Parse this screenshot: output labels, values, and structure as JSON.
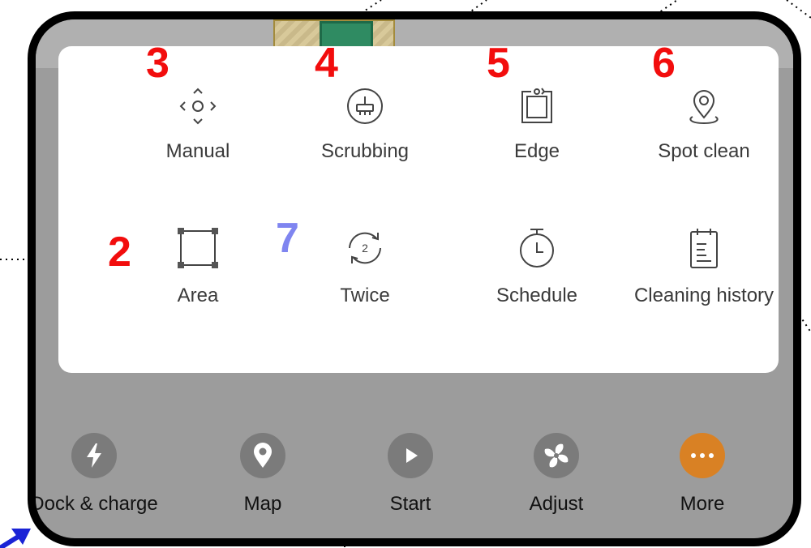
{
  "menu": {
    "row1": [
      {
        "label": "Manual",
        "number": "3"
      },
      {
        "label": "Scrubbing",
        "number": "4"
      },
      {
        "label": "Edge",
        "number": "5"
      },
      {
        "label": "Spot clean",
        "number": "6"
      }
    ],
    "row2": [
      {
        "label": "Area",
        "number": "2"
      },
      {
        "label": "Twice",
        "number": "7"
      },
      {
        "label": "Schedule"
      },
      {
        "label": "Cleaning history"
      }
    ]
  },
  "bottom_bar": [
    {
      "label": "Dock & charge"
    },
    {
      "label": "Map"
    },
    {
      "label": "Start"
    },
    {
      "label": "Adjust"
    },
    {
      "label": "More"
    }
  ],
  "colors": {
    "callout_number": "#f20d0d",
    "callout_number_twice": "#7f85f0",
    "more_accent": "#d98124"
  },
  "icons": [
    "move-arrows-icon",
    "broom-icon",
    "edge-icon",
    "location-pin-icon",
    "area-square-icon",
    "repeat-twice-icon",
    "timer-icon",
    "notepad-icon",
    "bolt-icon",
    "map-pin-icon",
    "play-icon",
    "fan-icon",
    "more-dots-icon"
  ]
}
